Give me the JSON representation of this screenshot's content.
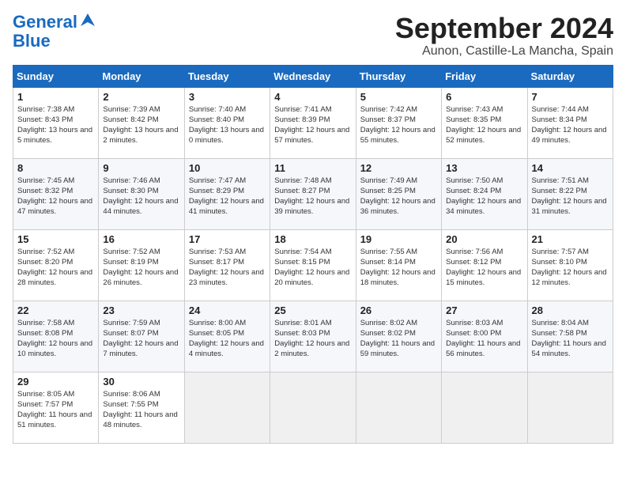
{
  "header": {
    "logo_line1": "General",
    "logo_line2": "Blue",
    "month_title": "September 2024",
    "location": "Aunon, Castille-La Mancha, Spain"
  },
  "days_of_week": [
    "Sunday",
    "Monday",
    "Tuesday",
    "Wednesday",
    "Thursday",
    "Friday",
    "Saturday"
  ],
  "weeks": [
    [
      {
        "day": "1",
        "sunrise": "Sunrise: 7:38 AM",
        "sunset": "Sunset: 8:43 PM",
        "daylight": "Daylight: 13 hours and 5 minutes."
      },
      {
        "day": "2",
        "sunrise": "Sunrise: 7:39 AM",
        "sunset": "Sunset: 8:42 PM",
        "daylight": "Daylight: 13 hours and 2 minutes."
      },
      {
        "day": "3",
        "sunrise": "Sunrise: 7:40 AM",
        "sunset": "Sunset: 8:40 PM",
        "daylight": "Daylight: 13 hours and 0 minutes."
      },
      {
        "day": "4",
        "sunrise": "Sunrise: 7:41 AM",
        "sunset": "Sunset: 8:39 PM",
        "daylight": "Daylight: 12 hours and 57 minutes."
      },
      {
        "day": "5",
        "sunrise": "Sunrise: 7:42 AM",
        "sunset": "Sunset: 8:37 PM",
        "daylight": "Daylight: 12 hours and 55 minutes."
      },
      {
        "day": "6",
        "sunrise": "Sunrise: 7:43 AM",
        "sunset": "Sunset: 8:35 PM",
        "daylight": "Daylight: 12 hours and 52 minutes."
      },
      {
        "day": "7",
        "sunrise": "Sunrise: 7:44 AM",
        "sunset": "Sunset: 8:34 PM",
        "daylight": "Daylight: 12 hours and 49 minutes."
      }
    ],
    [
      {
        "day": "8",
        "sunrise": "Sunrise: 7:45 AM",
        "sunset": "Sunset: 8:32 PM",
        "daylight": "Daylight: 12 hours and 47 minutes."
      },
      {
        "day": "9",
        "sunrise": "Sunrise: 7:46 AM",
        "sunset": "Sunset: 8:30 PM",
        "daylight": "Daylight: 12 hours and 44 minutes."
      },
      {
        "day": "10",
        "sunrise": "Sunrise: 7:47 AM",
        "sunset": "Sunset: 8:29 PM",
        "daylight": "Daylight: 12 hours and 41 minutes."
      },
      {
        "day": "11",
        "sunrise": "Sunrise: 7:48 AM",
        "sunset": "Sunset: 8:27 PM",
        "daylight": "Daylight: 12 hours and 39 minutes."
      },
      {
        "day": "12",
        "sunrise": "Sunrise: 7:49 AM",
        "sunset": "Sunset: 8:25 PM",
        "daylight": "Daylight: 12 hours and 36 minutes."
      },
      {
        "day": "13",
        "sunrise": "Sunrise: 7:50 AM",
        "sunset": "Sunset: 8:24 PM",
        "daylight": "Daylight: 12 hours and 34 minutes."
      },
      {
        "day": "14",
        "sunrise": "Sunrise: 7:51 AM",
        "sunset": "Sunset: 8:22 PM",
        "daylight": "Daylight: 12 hours and 31 minutes."
      }
    ],
    [
      {
        "day": "15",
        "sunrise": "Sunrise: 7:52 AM",
        "sunset": "Sunset: 8:20 PM",
        "daylight": "Daylight: 12 hours and 28 minutes."
      },
      {
        "day": "16",
        "sunrise": "Sunrise: 7:52 AM",
        "sunset": "Sunset: 8:19 PM",
        "daylight": "Daylight: 12 hours and 26 minutes."
      },
      {
        "day": "17",
        "sunrise": "Sunrise: 7:53 AM",
        "sunset": "Sunset: 8:17 PM",
        "daylight": "Daylight: 12 hours and 23 minutes."
      },
      {
        "day": "18",
        "sunrise": "Sunrise: 7:54 AM",
        "sunset": "Sunset: 8:15 PM",
        "daylight": "Daylight: 12 hours and 20 minutes."
      },
      {
        "day": "19",
        "sunrise": "Sunrise: 7:55 AM",
        "sunset": "Sunset: 8:14 PM",
        "daylight": "Daylight: 12 hours and 18 minutes."
      },
      {
        "day": "20",
        "sunrise": "Sunrise: 7:56 AM",
        "sunset": "Sunset: 8:12 PM",
        "daylight": "Daylight: 12 hours and 15 minutes."
      },
      {
        "day": "21",
        "sunrise": "Sunrise: 7:57 AM",
        "sunset": "Sunset: 8:10 PM",
        "daylight": "Daylight: 12 hours and 12 minutes."
      }
    ],
    [
      {
        "day": "22",
        "sunrise": "Sunrise: 7:58 AM",
        "sunset": "Sunset: 8:08 PM",
        "daylight": "Daylight: 12 hours and 10 minutes."
      },
      {
        "day": "23",
        "sunrise": "Sunrise: 7:59 AM",
        "sunset": "Sunset: 8:07 PM",
        "daylight": "Daylight: 12 hours and 7 minutes."
      },
      {
        "day": "24",
        "sunrise": "Sunrise: 8:00 AM",
        "sunset": "Sunset: 8:05 PM",
        "daylight": "Daylight: 12 hours and 4 minutes."
      },
      {
        "day": "25",
        "sunrise": "Sunrise: 8:01 AM",
        "sunset": "Sunset: 8:03 PM",
        "daylight": "Daylight: 12 hours and 2 minutes."
      },
      {
        "day": "26",
        "sunrise": "Sunrise: 8:02 AM",
        "sunset": "Sunset: 8:02 PM",
        "daylight": "Daylight: 11 hours and 59 minutes."
      },
      {
        "day": "27",
        "sunrise": "Sunrise: 8:03 AM",
        "sunset": "Sunset: 8:00 PM",
        "daylight": "Daylight: 11 hours and 56 minutes."
      },
      {
        "day": "28",
        "sunrise": "Sunrise: 8:04 AM",
        "sunset": "Sunset: 7:58 PM",
        "daylight": "Daylight: 11 hours and 54 minutes."
      }
    ],
    [
      {
        "day": "29",
        "sunrise": "Sunrise: 8:05 AM",
        "sunset": "Sunset: 7:57 PM",
        "daylight": "Daylight: 11 hours and 51 minutes."
      },
      {
        "day": "30",
        "sunrise": "Sunrise: 8:06 AM",
        "sunset": "Sunset: 7:55 PM",
        "daylight": "Daylight: 11 hours and 48 minutes."
      },
      {
        "day": "",
        "sunrise": "",
        "sunset": "",
        "daylight": ""
      },
      {
        "day": "",
        "sunrise": "",
        "sunset": "",
        "daylight": ""
      },
      {
        "day": "",
        "sunrise": "",
        "sunset": "",
        "daylight": ""
      },
      {
        "day": "",
        "sunrise": "",
        "sunset": "",
        "daylight": ""
      },
      {
        "day": "",
        "sunrise": "",
        "sunset": "",
        "daylight": ""
      }
    ]
  ]
}
